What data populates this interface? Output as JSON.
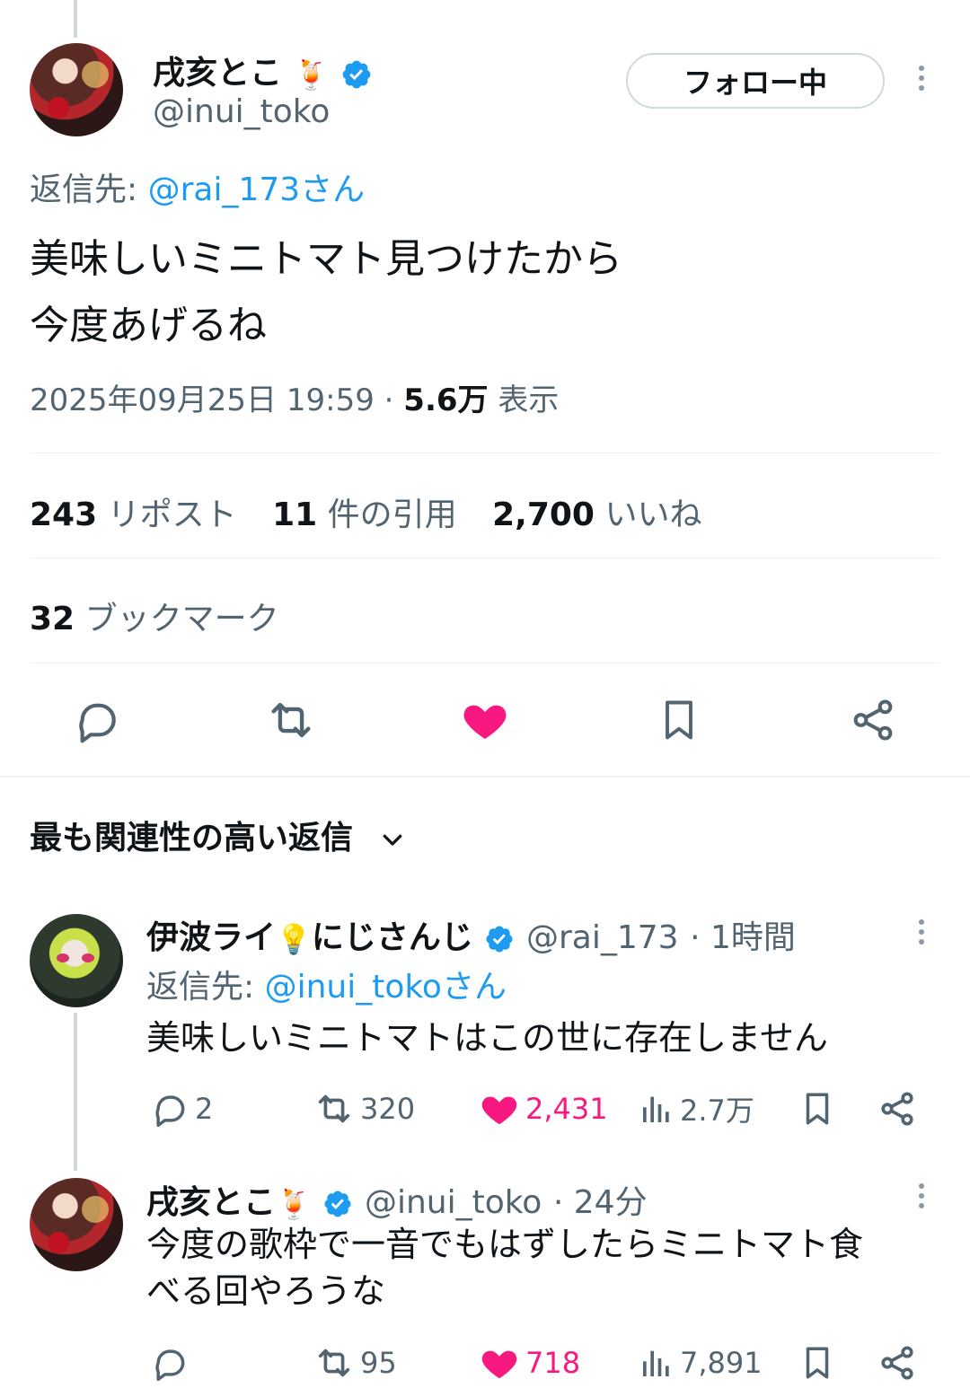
{
  "main_tweet": {
    "author_name": "戌亥とこ",
    "name_emoji": "🍹",
    "handle": "@inui_toko",
    "follow_label": "フォロー中",
    "reply_prefix": "返信先:",
    "reply_target": "@rai_173さん",
    "text_line1": "美味しいミニトマト見つけたから",
    "text_line2": "今度あげるね",
    "timestamp": "2025年09月25日 19:59",
    "separator": "·",
    "views_count": "5.6万",
    "views_label": "表示",
    "reposts_count": "243",
    "reposts_label": "リポスト",
    "quotes_count": "11",
    "quotes_label": "件の引用",
    "likes_count": "2,700",
    "likes_label": "いいね",
    "bookmarks_count": "32",
    "bookmarks_label": "ブックマーク"
  },
  "replies_section": {
    "title": "最も関連性の高い返信"
  },
  "replies": [
    {
      "author_name": "伊波ライ",
      "name_emoji": "💡",
      "name_suffix": "にじさんじ",
      "handle": "@rai_173",
      "time": "· 1時間",
      "reply_prefix": "返信先:",
      "reply_target": "@inui_tokoさん",
      "text": "美味しいミニトマトはこの世に存在しません",
      "replies": "2",
      "reposts": "320",
      "likes": "2,431",
      "views": "2.7万"
    },
    {
      "author_name": "戌亥とこ",
      "name_emoji": "🍹",
      "handle": "@inui_toko",
      "time": "· 24分",
      "text_line1": "今度の歌枠で一音でもはずしたらミニトマト食",
      "text_line2": "べる回やろうな",
      "replies": "",
      "reposts": "95",
      "likes": "718",
      "views": "7,891"
    }
  ],
  "colors": {
    "accent": "#1d9bf0",
    "like": "#f91880",
    "secondary_text": "#536471",
    "divider": "#eff3f4"
  }
}
